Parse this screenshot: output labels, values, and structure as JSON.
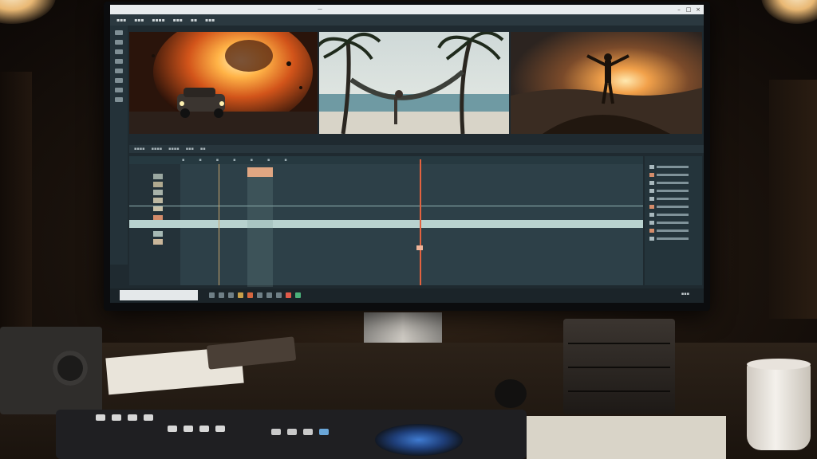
{
  "scene": {
    "description_colors": {
      "screen_bg": "#1f2a30",
      "playhead": "#e3623f",
      "selected_track": "#b8d2cf",
      "clip_marker": "#e0a682"
    }
  },
  "editor": {
    "menu": [
      "",
      "",
      "",
      "",
      "",
      ""
    ],
    "taskbar": {
      "search_placeholder": ""
    }
  }
}
